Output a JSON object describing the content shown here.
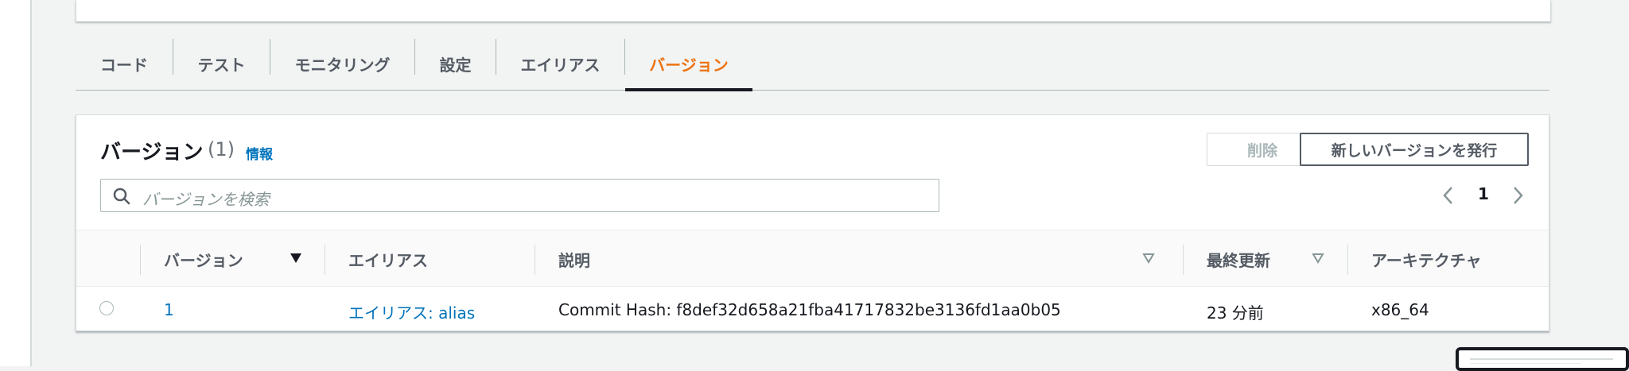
{
  "tabs": [
    {
      "label": "コード"
    },
    {
      "label": "テスト"
    },
    {
      "label": "モニタリング"
    },
    {
      "label": "設定"
    },
    {
      "label": "エイリアス"
    },
    {
      "label": "バージョン",
      "active": true
    }
  ],
  "versions_panel": {
    "title": "バージョン",
    "count": "(1)",
    "info_link": "情報",
    "delete_button": "削除",
    "publish_button": "新しいバージョンを発行",
    "search_placeholder": "バージョンを検索",
    "page_number": "1"
  },
  "table": {
    "headers": {
      "version": "バージョン",
      "alias": "エイリアス",
      "description": "説明",
      "last_modified": "最終更新",
      "architecture": "アーキテクチャ"
    },
    "rows": [
      {
        "version": "1",
        "alias": "エイリアス: alias",
        "description": "Commit Hash: f8def32d658a21fba41717832be3136fd1aa0b05",
        "last_modified": "23 分前",
        "architecture": "x86_64"
      }
    ]
  },
  "colors": {
    "accent": "#ec7211",
    "link": "#0073bb",
    "text": "#16191f",
    "muted": "#545b64"
  },
  "icons": [
    "search-icon",
    "chevron-left-icon",
    "chevron-right-icon",
    "sort-desc-filled-icon",
    "sort-outline-icon"
  ]
}
